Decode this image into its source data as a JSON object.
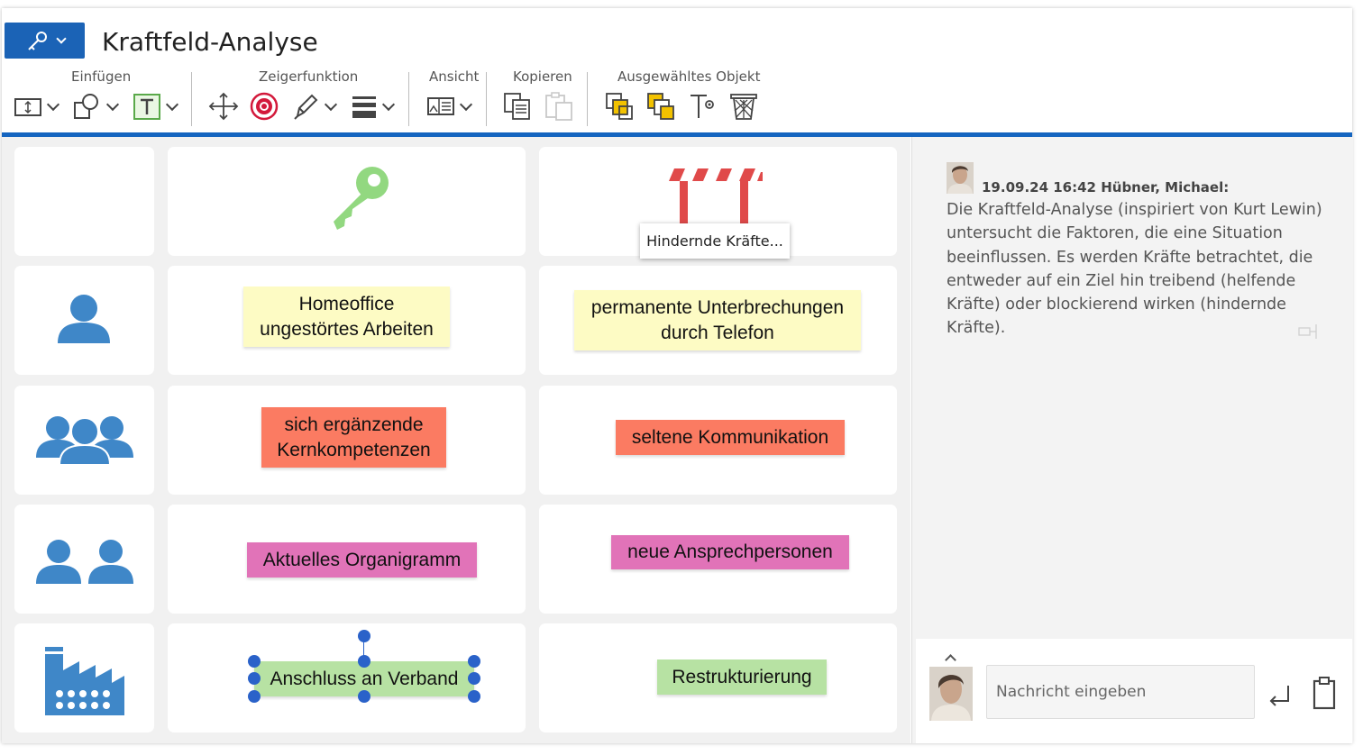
{
  "header": {
    "title": "Kraftfeld-Analyse",
    "groups": {
      "insert": "Einfügen",
      "pointer": "Zeigerfunktion",
      "view": "Ansicht",
      "copy": "Kopieren",
      "selected": "Ausgewähltes Objekt"
    }
  },
  "colors": {
    "accent": "#1565c0",
    "yellow_note": "#fdfbc4",
    "orange_note": "#fb7b62",
    "pink_note": "#e173b8",
    "green_note": "#b7e2a3",
    "icon_blue": "#3f87c8",
    "key_green": "#92d880",
    "barrier_red": "#e04a4a"
  },
  "board": {
    "tooltip": "Hindernde Kräfte...",
    "rows": [
      {
        "icon": "person-icon",
        "helping": "Homeoffice\nungestörtes Arbeiten",
        "hindering": "permanente Unterbrechungen\ndurch Telefon"
      },
      {
        "icon": "group-icon",
        "helping": "sich ergänzende\nKernkompetenzen",
        "hindering": "seltene Kommunikation"
      },
      {
        "icon": "two-people-icon",
        "helping": "Aktuelles Organigramm",
        "hindering": "neue Ansprechpersonen"
      },
      {
        "icon": "factory-icon",
        "helping": "Anschluss an Verband",
        "hindering": "Restrukturierung"
      }
    ]
  },
  "chat": {
    "messages": [
      {
        "meta": "19.09.24 16:42 Hübner, Michael:",
        "text": "Die Kraftfeld-Analyse (inspiriert von Kurt Lewin) untersucht die Faktoren, die eine Situation beeinflussen. Es werden Kräfte betrachtet, die entweder auf ein Ziel hin treibend (helfende Kräfte) oder blockierend wirken (hindernde Kräfte)."
      }
    ],
    "input_placeholder": "Nachricht eingeben"
  }
}
